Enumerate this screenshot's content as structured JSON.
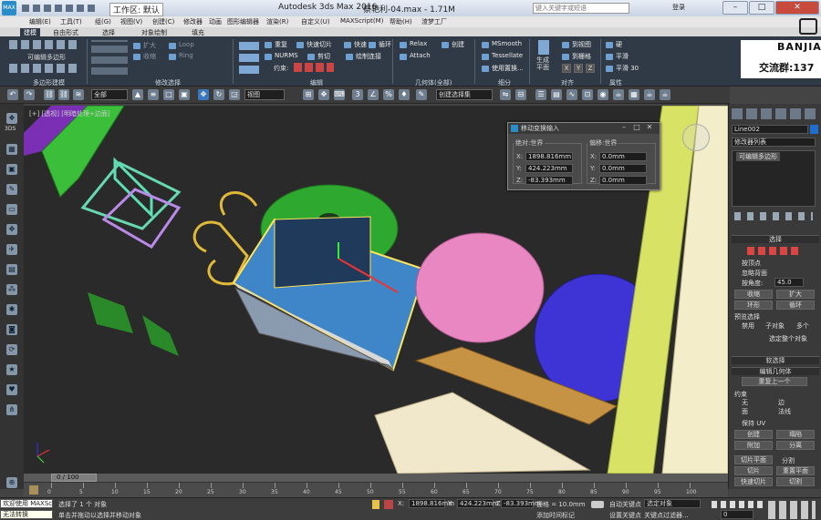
{
  "titlebar": {
    "workspace_label": "工作区: 默认",
    "app_title": "Autodesk 3ds Max 2016",
    "file_title": "蔡艳利-04.max - 1.71M",
    "search_placeholder": "键入关键字或短语",
    "login": "登录"
  },
  "menu": [
    "编辑(E)",
    "工具(T)",
    "组(G)",
    "视图(V)",
    "创建(C)",
    "修改器",
    "动画",
    "图形编辑器",
    "渲染(R)",
    "自定义(U)",
    "MAXScript(M)",
    "帮助(H)",
    "渣梦工厂"
  ],
  "ribbon_tabs": [
    "建模",
    "自由形式",
    "选择",
    "对象绘制",
    "填充"
  ],
  "ribbon": {
    "left_items": [
      "扩大",
      "收缩",
      "Loop",
      "Ring",
      "修改选择"
    ],
    "edit_poly": "可编辑多边形",
    "group_polymodel": "多边形建模",
    "group_modsel": "修改选择",
    "group_edit": "编辑",
    "group_geometry": "几何体(全部)",
    "group_subdiv": "细分",
    "group_align": "对齐",
    "group_props": "属性",
    "edit": [
      "重复",
      "快速切片",
      "快速",
      "循环",
      "NURMS",
      "剪切",
      "约束:",
      "绘制连接"
    ],
    "geometry": [
      "Relax",
      "创建",
      "Attach"
    ],
    "subdiv": [
      "MSmooth",
      "Tessellate",
      "使用置换..."
    ],
    "align": [
      "生成平面",
      "到视图",
      "到栅格",
      "X",
      "Y",
      "Z"
    ],
    "props": [
      "硬",
      "平滑",
      "平滑 30"
    ]
  },
  "brand": {
    "logo": "BANJIA",
    "qq": "交流群:137"
  },
  "toolbar": {
    "selection_filter": "全部",
    "ref_coord": "视图",
    "named_sel": "创建选择集"
  },
  "left_tools": [
    "3DS"
  ],
  "viewport": {
    "label": "[+] [透视] [明暗处理+边面]"
  },
  "dialog": {
    "title": "移动变换输入",
    "abs_legend": "绝对:世界",
    "off_legend": "偏移:世界",
    "abs": [
      {
        "axis": "X:",
        "value": "1898.816mm"
      },
      {
        "axis": "Y:",
        "value": "424.223mm"
      },
      {
        "axis": "Z:",
        "value": "-83.393mm"
      }
    ],
    "off": [
      {
        "axis": "X:",
        "value": "0.0mm"
      },
      {
        "axis": "Y:",
        "value": "0.0mm"
      },
      {
        "axis": "Z:",
        "value": "0.0mm"
      }
    ]
  },
  "rightpanel": {
    "object_name": "Line002",
    "modifier_list": "修改器列表",
    "stack_item": "可编辑多边形",
    "rollout_select": "选择",
    "by_vertex": "按顶点",
    "ignore_back": "忽略背面",
    "by_angle": "按角度:",
    "angle_value": "45.0",
    "shrink": "收缩",
    "grow": "扩大",
    "ring": "环形",
    "loop": "循环",
    "preview_sel": "预览选择",
    "disable": "禁用",
    "sub_obj": "子对象",
    "multi": "多个",
    "whole_sel": "选定整个对象",
    "soft_sel": "软选择",
    "edit_geom": "编辑几何体",
    "repeat_last": "重复上一个",
    "constraint": "约束",
    "c_none": "无",
    "c_edge": "边",
    "c_face": "面",
    "c_normal": "法线",
    "keep_uv": "保持 UV",
    "create": "创建",
    "collapse": "塌陷",
    "attach": "附加",
    "detach": "分离",
    "slice_plane": "切片平面",
    "split": "分割",
    "slice": "切片",
    "reset_plane": "重置平面",
    "quickslice": "快速切片",
    "cut": "切割"
  },
  "timeslider": {
    "label": "0 / 100"
  },
  "track_ticks": [
    "0",
    "5",
    "10",
    "15",
    "20",
    "25",
    "30",
    "35",
    "40",
    "45",
    "50",
    "55",
    "60",
    "65",
    "70",
    "75",
    "80",
    "85",
    "90",
    "95",
    "100"
  ],
  "status": {
    "selected": "选择了 1 个 对象",
    "prompt": "单击并拖动以选择并移动对象",
    "x_label": "X:",
    "x": "1898.816mm",
    "y_label": "Y:",
    "y": "424.223mm",
    "z_label": "Z:",
    "z": "-83.393mm",
    "grid": "栅格 = 10.0mm",
    "add_tag": "添加时间标记",
    "autokey": "自动关键点",
    "selected_obj": "选定对象",
    "setkey": "设置关键点",
    "keyfilter": "关键点过滤器...",
    "frame": "0",
    "maxscript": "欢迎使用 MAXSc",
    "lightmap": "无法转换"
  }
}
